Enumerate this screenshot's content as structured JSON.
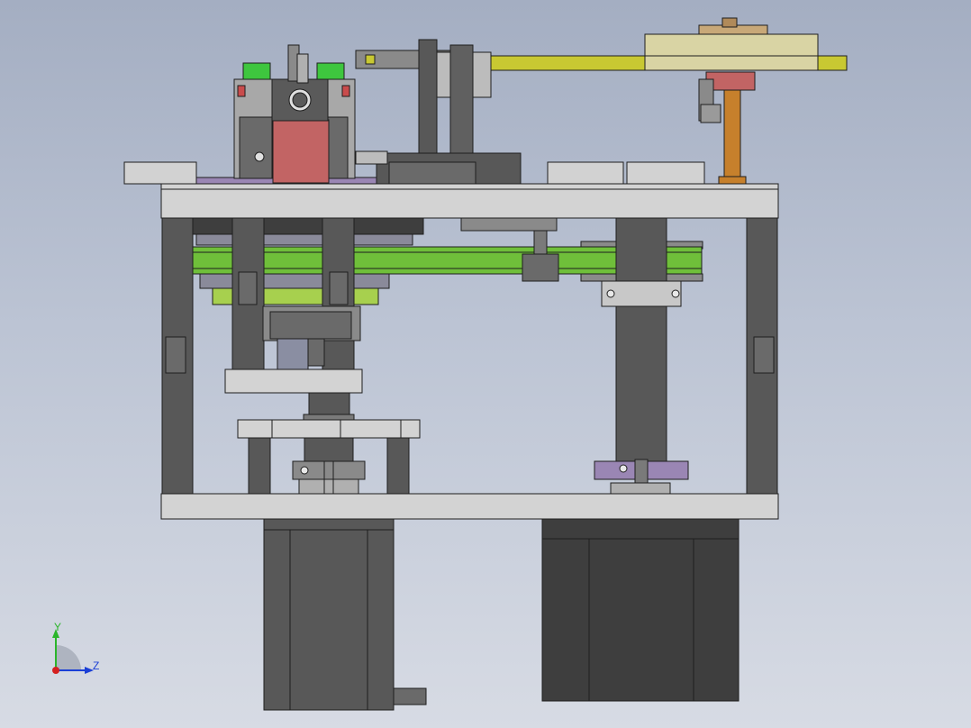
{
  "view": {
    "axes": {
      "y_label": "Y",
      "z_label": "Z",
      "y_color": "#2bb52b",
      "z_color": "#1b3fd6",
      "x_color": "#d42020"
    }
  },
  "colors": {
    "frame_light": "#d3d3d3",
    "column": "#585858",
    "motor": "#4a4a4a",
    "belt_green": "#6fbf3a",
    "belt_yellow": "#c8c832",
    "pulley_tan": "#d9d4a4",
    "block_red": "#c26464",
    "shaft_copper": "#c6802c",
    "purple_plate": "#9a86b4",
    "connector_green": "#3ec63e"
  }
}
